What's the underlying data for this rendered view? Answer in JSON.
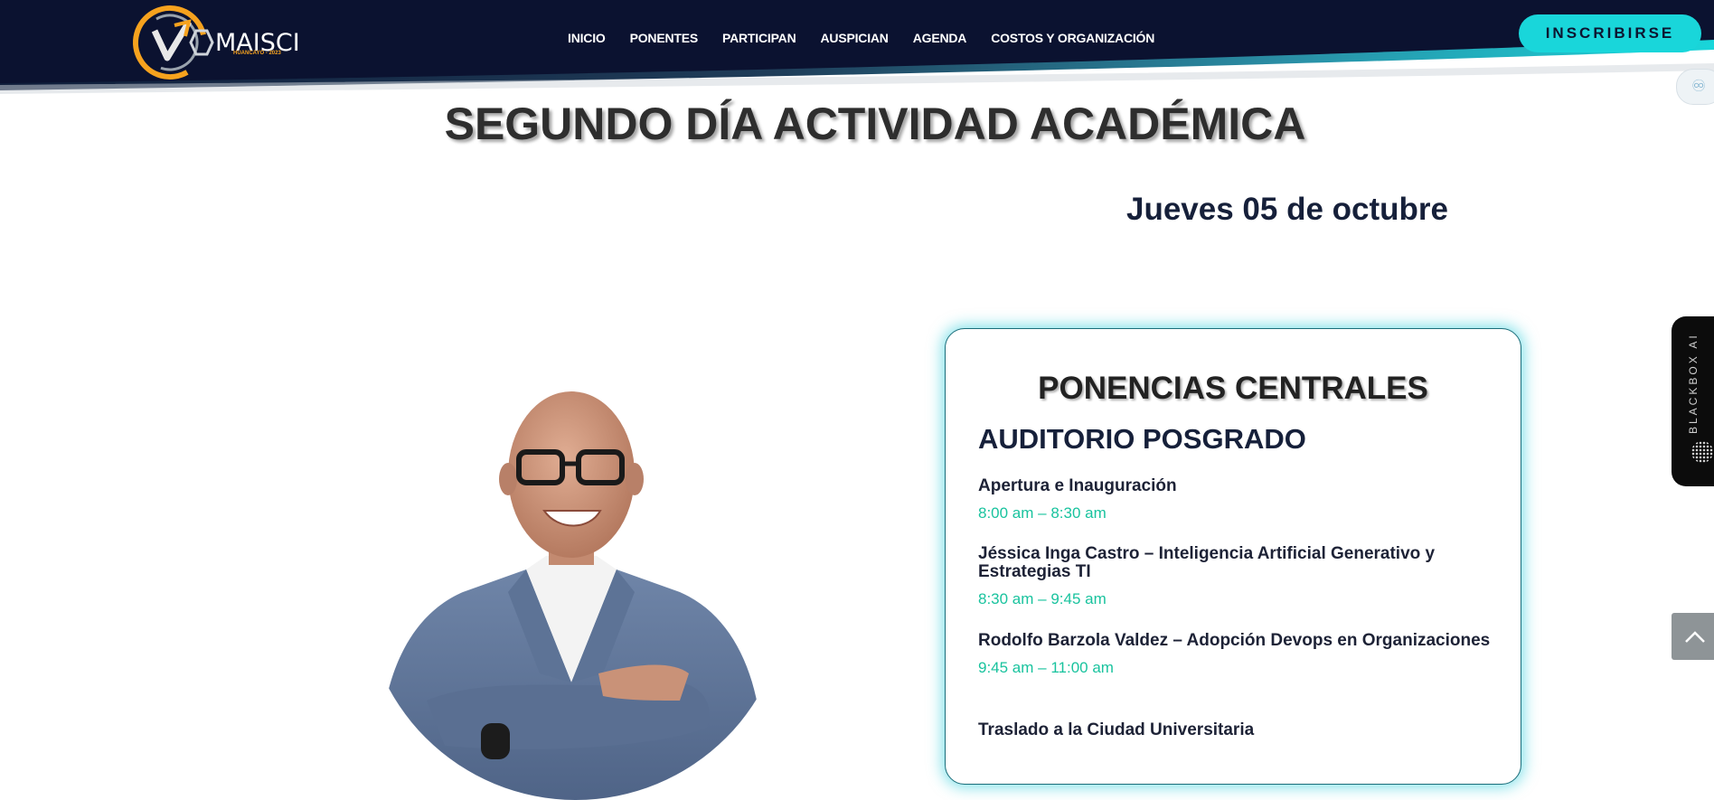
{
  "header": {
    "logo_text": "MAISCI",
    "logo_sub": "HUANCAYO - 2023",
    "nav": [
      "INICIO",
      "PONENTES",
      "PARTICIPAN",
      "AUSPICIAN",
      "AGENDA",
      "COSTOS Y ORGANIZACIÓN"
    ],
    "cta": "INSCRIBIRSE"
  },
  "main": {
    "title": "SEGUNDO DÍA ACTIVIDAD ACADÉMICA",
    "date": "Jueves 05 de octubre"
  },
  "card": {
    "title": "PONENCIAS CENTRALES",
    "subtitle": "AUDITORIO POSGRADO",
    "items": [
      {
        "title": "Apertura e Inauguración",
        "time": "8:00 am – 8:30 am"
      },
      {
        "title": "Jéssica Inga Castro – Inteligencia Artificial Generativo y Estrategias TI",
        "time": "8:30 am – 9:45 am"
      },
      {
        "title": "Rodolfo Barzola Valdez – Adopción Devops en Organizaciones",
        "time": "9:45 am – 11:00 am"
      },
      {
        "title": "Traslado a la Ciudad Universitaria",
        "time": ""
      }
    ]
  },
  "widgets": {
    "blackbox_label": "BLACKBOX AI"
  },
  "colors": {
    "header_bg": "#0b1230",
    "accent_cyan": "#19d6da",
    "time_green": "#19c39e",
    "logo_orange": "#f6a21e"
  }
}
